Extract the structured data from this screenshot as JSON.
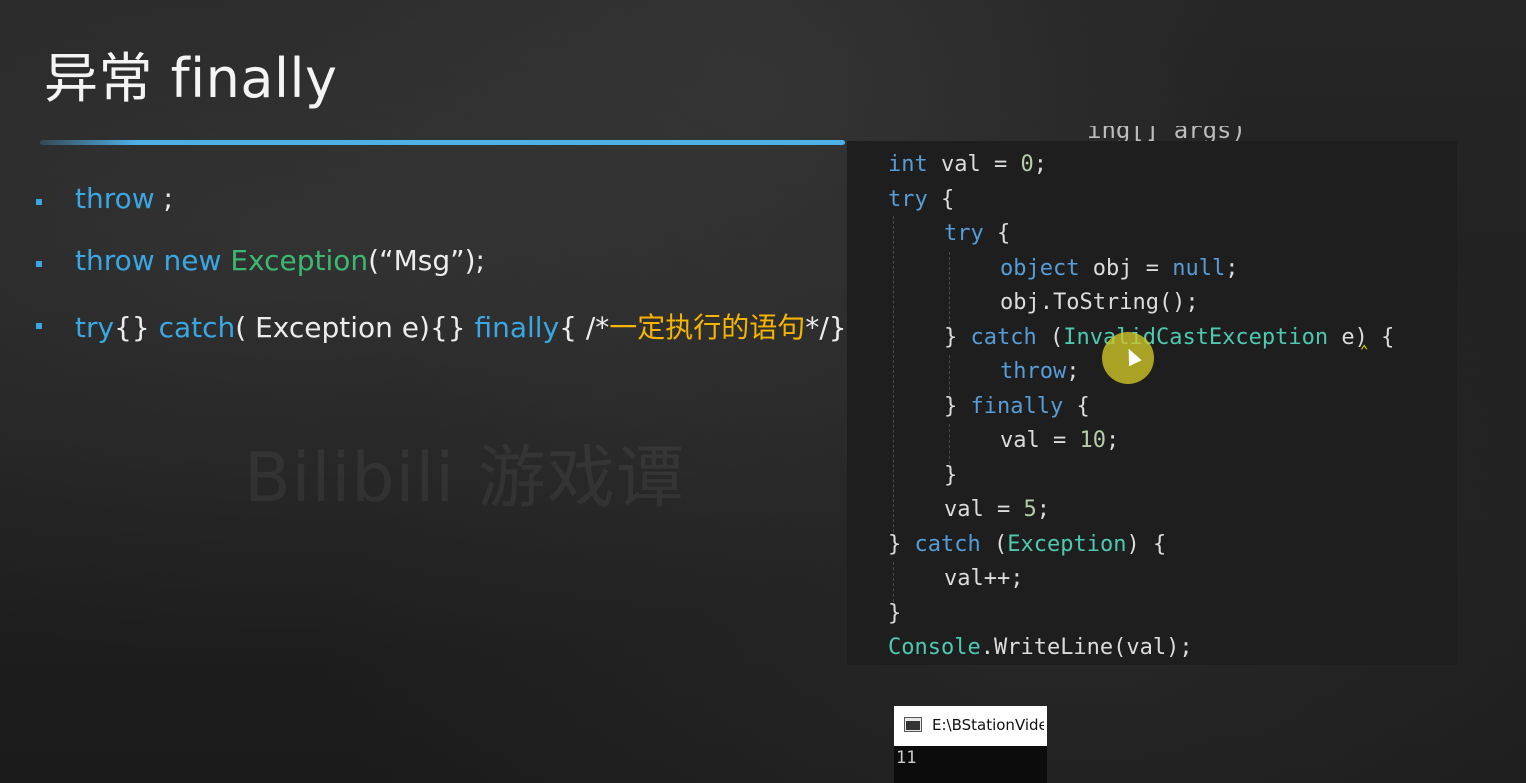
{
  "slide": {
    "title": "异常 finally",
    "watermark": "Bilibili 游戏谭"
  },
  "bullets": [
    {
      "parts": [
        {
          "text": "throw",
          "style": "kw"
        },
        {
          "text": " ;",
          "style": "plain"
        }
      ]
    },
    {
      "parts": [
        {
          "text": "throw new ",
          "style": "kw"
        },
        {
          "text": "Exception",
          "style": "cls"
        },
        {
          "text": "(“Msg”);",
          "style": "plain"
        }
      ]
    },
    {
      "parts": [
        {
          "text": "try",
          "style": "kw"
        },
        {
          "text": "{} ",
          "style": "plain"
        },
        {
          "text": "catch",
          "style": "kw"
        },
        {
          "text": "( Exception e){} ",
          "style": "plain"
        },
        {
          "text": "finally",
          "style": "kw"
        },
        {
          "text": "{ /*",
          "style": "plain"
        },
        {
          "text": "一定执行的语句",
          "style": "cmt"
        },
        {
          "text": "*/}",
          "style": "plain"
        }
      ]
    }
  ],
  "code": {
    "top_cut": "ing[] args)",
    "lines": [
      {
        "indent": 0,
        "tokens": [
          {
            "t": "int",
            "c": "kw"
          },
          {
            "t": " val = ",
            "c": "pl"
          },
          {
            "t": "0",
            "c": "nu"
          },
          {
            "t": ";",
            "c": "pl"
          }
        ]
      },
      {
        "indent": 0,
        "tokens": [
          {
            "t": "try",
            "c": "kw"
          },
          {
            "t": " {",
            "c": "pl"
          }
        ]
      },
      {
        "indent": 1,
        "tokens": [
          {
            "t": "try",
            "c": "kw"
          },
          {
            "t": " {",
            "c": "pl"
          }
        ]
      },
      {
        "indent": 2,
        "tokens": [
          {
            "t": "object",
            "c": "kw"
          },
          {
            "t": " obj = ",
            "c": "pl"
          },
          {
            "t": "null",
            "c": "kw"
          },
          {
            "t": ";",
            "c": "pl"
          }
        ]
      },
      {
        "indent": 2,
        "tokens": [
          {
            "t": "obj.ToString();",
            "c": "pl"
          }
        ]
      },
      {
        "indent": 1,
        "tokens": [
          {
            "t": "} ",
            "c": "pl"
          },
          {
            "t": "catch",
            "c": "kw"
          },
          {
            "t": " (",
            "c": "pl"
          },
          {
            "t": "InvalidCastException",
            "c": "ty"
          },
          {
            "t": " e) {",
            "c": "pl"
          }
        ]
      },
      {
        "indent": 2,
        "tokens": [
          {
            "t": "throw",
            "c": "kw"
          },
          {
            "t": ";",
            "c": "pl"
          }
        ]
      },
      {
        "indent": 1,
        "tokens": [
          {
            "t": "} ",
            "c": "pl"
          },
          {
            "t": "finally",
            "c": "kw"
          },
          {
            "t": " {",
            "c": "pl"
          }
        ]
      },
      {
        "indent": 2,
        "tokens": [
          {
            "t": "val = ",
            "c": "pl"
          },
          {
            "t": "10",
            "c": "nu"
          },
          {
            "t": ";",
            "c": "pl"
          }
        ]
      },
      {
        "indent": 1,
        "tokens": [
          {
            "t": "}",
            "c": "pl"
          }
        ]
      },
      {
        "indent": 1,
        "tokens": [
          {
            "t": "val = ",
            "c": "pl"
          },
          {
            "t": "5",
            "c": "nu"
          },
          {
            "t": ";",
            "c": "pl"
          }
        ]
      },
      {
        "indent": 0,
        "tokens": [
          {
            "t": "} ",
            "c": "pl"
          },
          {
            "t": "catch",
            "c": "kw"
          },
          {
            "t": " (",
            "c": "pl"
          },
          {
            "t": "Exception",
            "c": "ty"
          },
          {
            "t": ") {",
            "c": "pl"
          }
        ]
      },
      {
        "indent": 1,
        "tokens": [
          {
            "t": "val++;",
            "c": "pl"
          }
        ]
      },
      {
        "indent": 0,
        "tokens": [
          {
            "t": "}",
            "c": "pl"
          }
        ]
      },
      {
        "indent": 0,
        "tokens": [
          {
            "t": "Console",
            "c": "ty"
          },
          {
            "t": ".WriteLine(val);",
            "c": "pl"
          }
        ]
      }
    ]
  },
  "console": {
    "title": "E:\\BStationVide",
    "output": "11"
  },
  "colors": {
    "accent_blue": "#3aa7e2",
    "class_green": "#3cb872",
    "comment_yellow": "#f5b400",
    "cursor_highlight": "#d2c828"
  },
  "icons": [
    "console-window-icon",
    "mouse-cursor-icon"
  ]
}
